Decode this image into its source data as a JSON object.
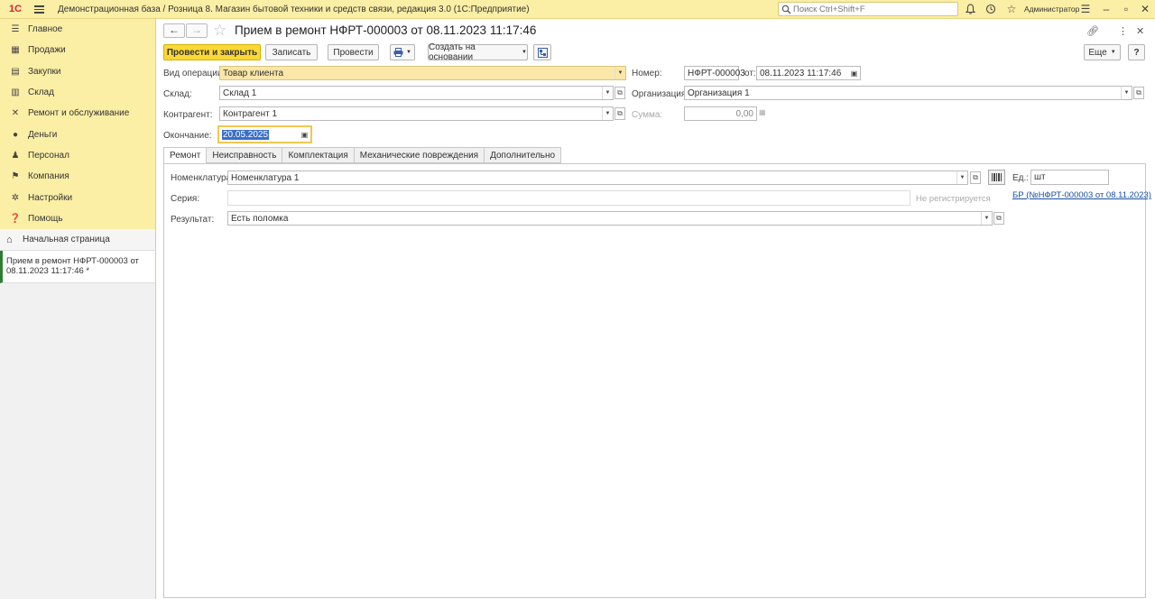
{
  "app": {
    "logo_text": "1С",
    "title": "Демонстрационная база / Розница 8. Магазин бытовой техники и средств связи, редакция 3.0  (1С:Предприятие)",
    "search_placeholder": "Поиск Ctrl+Shift+F",
    "user": "Администратор"
  },
  "sidebar": {
    "items": [
      {
        "label": "Главное",
        "icon": "menu-icon"
      },
      {
        "label": "Продажи",
        "icon": "cart-icon"
      },
      {
        "label": "Закупки",
        "icon": "basket-icon"
      },
      {
        "label": "Склад",
        "icon": "warehouse-icon"
      },
      {
        "label": "Ремонт и обслуживание",
        "icon": "tools-icon"
      },
      {
        "label": "Деньги",
        "icon": "money-icon"
      },
      {
        "label": "Персонал",
        "icon": "people-icon"
      },
      {
        "label": "Компания",
        "icon": "flag-icon"
      },
      {
        "label": "Настройки",
        "icon": "gear-icon"
      },
      {
        "label": "Помощь",
        "icon": "help-icon"
      }
    ],
    "home": "Начальная страница",
    "open_doc": "Прием в ремонт НФРТ-000003 от 08.11.2023 11:17:46 *"
  },
  "document": {
    "title": "Прием в ремонт НФРТ-000003 от 08.11.2023 11:17:46",
    "toolbar": {
      "post_close": "Провести и закрыть",
      "save": "Записать",
      "post": "Провести",
      "create_based": "Создать на основании",
      "more": "Еще",
      "help": "?"
    },
    "fields": {
      "op_type_label": "Вид операции:",
      "op_type_value": "Товар клиента",
      "number_label": "Номер:",
      "number_value": "НФРТ-000003",
      "from_label": "от:",
      "date_value": "08.11.2023 11:17:46",
      "warehouse_label": "Склад:",
      "warehouse_value": "Склад 1",
      "org_label": "Организация:",
      "org_value": "Организация 1",
      "counterparty_label": "Контрагент:",
      "counterparty_value": "Контрагент 1",
      "sum_label": "Сумма:",
      "sum_value": "0,00",
      "end_label": "Окончание:",
      "end_value": "20.05.2025"
    },
    "tabs": [
      {
        "label": "Ремонт",
        "active": true
      },
      {
        "label": "Неисправность",
        "active": false
      },
      {
        "label": "Комплектация",
        "active": false
      },
      {
        "label": "Механические повреждения",
        "active": false
      },
      {
        "label": "Дополнительно",
        "active": false
      }
    ],
    "repair_tab": {
      "nomenclature_label": "Номенклатура:",
      "nomenclature_value": "Номенклатура 1",
      "unit_label": "Ед.:",
      "unit_value": "шт",
      "series_label": "Серия:",
      "series_value": "",
      "not_registered": "Не регистрируется",
      "link": "БР (№НФРТ-000003 от 08.11.2023)",
      "result_label": "Результат:",
      "result_value": "Есть поломка"
    }
  }
}
